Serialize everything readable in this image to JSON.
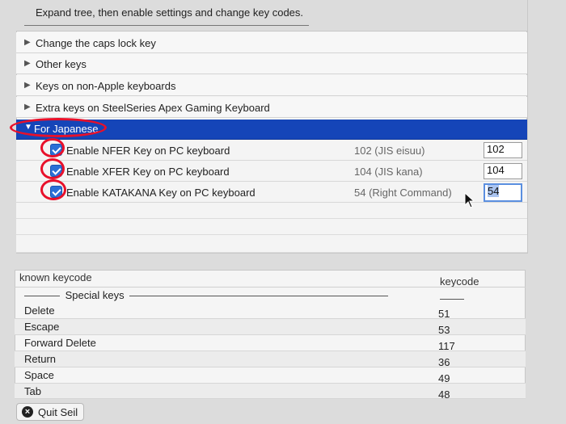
{
  "instruction": "Expand tree, then enable settings and change key codes.",
  "tree": {
    "items": [
      {
        "label": "Change the caps lock key",
        "expanded": false
      },
      {
        "label": "Other keys",
        "expanded": false
      },
      {
        "label": "Keys on non-Apple keyboards",
        "expanded": false
      },
      {
        "label": "Extra keys on SteelSeries Apex Gaming Keyboard",
        "expanded": false
      },
      {
        "label": "For Japanese",
        "expanded": true,
        "selected": true
      }
    ],
    "children": [
      {
        "label": "Enable NFER Key on PC keyboard",
        "checked": true,
        "key_name": "102 (JIS eisuu)",
        "value": "102"
      },
      {
        "label": "Enable XFER Key on PC keyboard",
        "checked": true,
        "key_name": "104 (JIS kana)",
        "value": "104"
      },
      {
        "label": "Enable KATAKANA Key on PC keyboard",
        "checked": true,
        "key_name": "54 (Right Command)",
        "value": "54"
      }
    ]
  },
  "known_keycodes": {
    "header_name": "known keycode",
    "header_code": "keycode",
    "section": "Special keys",
    "rows": [
      {
        "name": "Delete",
        "code": "51"
      },
      {
        "name": "Escape",
        "code": "53"
      },
      {
        "name": "Forward Delete",
        "code": "117"
      },
      {
        "name": "Return",
        "code": "36"
      },
      {
        "name": "Space",
        "code": "49"
      },
      {
        "name": "Tab",
        "code": "48"
      }
    ]
  },
  "quit_button": {
    "label": "Quit Seil"
  },
  "colors": {
    "selection": "#1545b8",
    "annotation": "#e8102a",
    "checkbox": "#2a6fd6"
  }
}
